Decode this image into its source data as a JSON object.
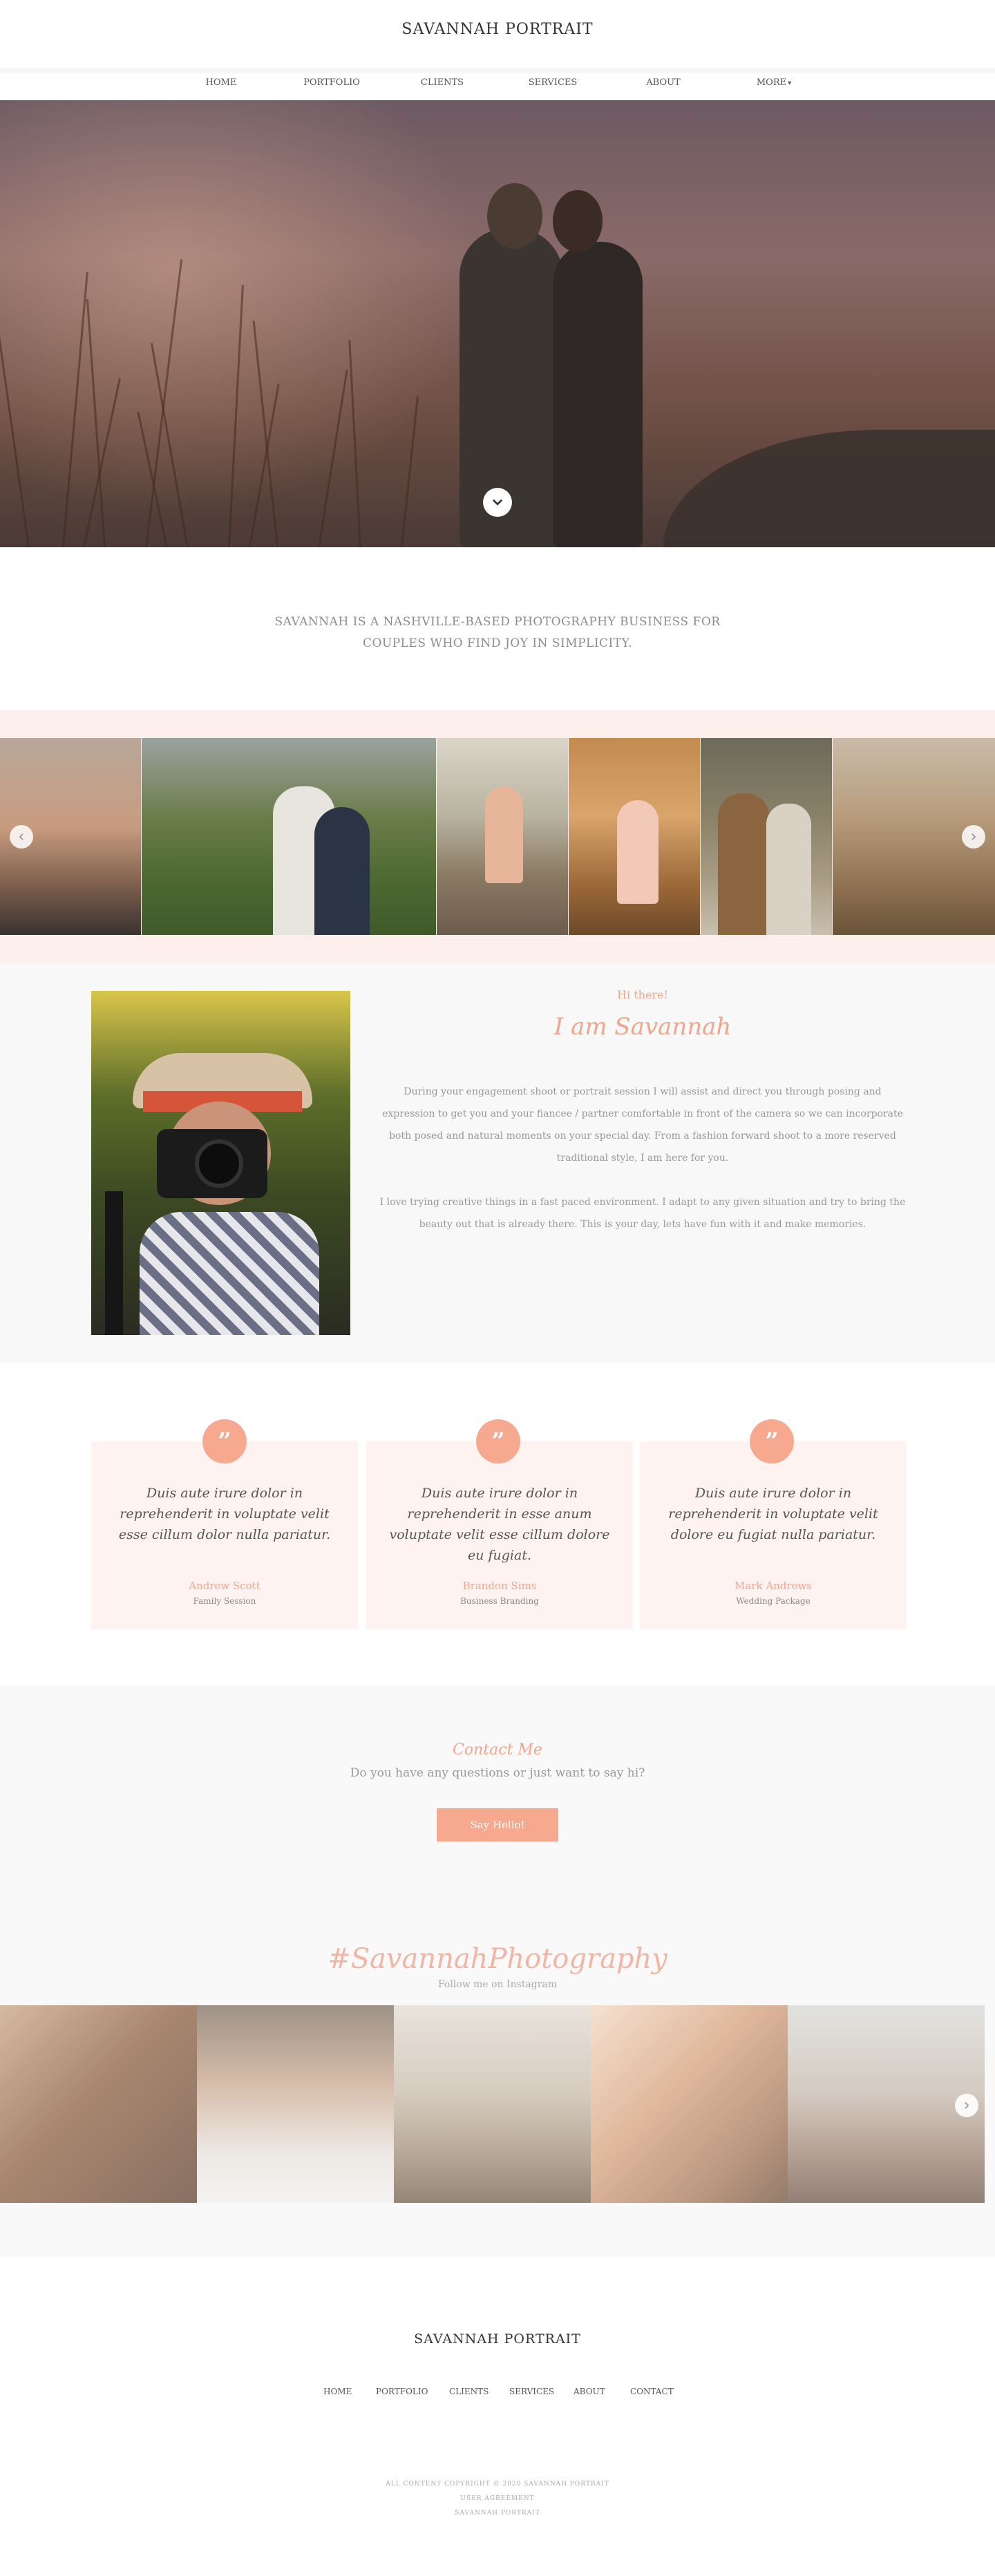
{
  "header": {
    "brand": "SAVANNAH PORTRAIT",
    "nav": [
      {
        "label": "HOME"
      },
      {
        "label": "PORTFOLIO"
      },
      {
        "label": "CLIENTS"
      },
      {
        "label": "SERVICES"
      },
      {
        "label": "ABOUT"
      },
      {
        "label": "MORE"
      }
    ]
  },
  "hero": {
    "scroll_icon": "chevron-down-icon"
  },
  "intro": {
    "text": "SAVANNAH IS A NASHVILLE-BASED PHOTOGRAPHY BUSINESS FOR COUPLES WHO FIND JOY IN SIMPLICITY."
  },
  "gallery": {
    "prev_icon": "chevron-left-icon",
    "next_icon": "chevron-right-icon"
  },
  "about": {
    "greeting": "Hi there!",
    "heading": "I am Savannah",
    "paragraph1": "During your engagement shoot or portrait session I will assist and direct you through posing and expression to get you and your fiancee / partner comfortable in front of the camera so we can incorporate both posed and natural moments on your special day. From a fashion forward shoot to a more reserved traditional style, I am here for you.",
    "paragraph2": "I love trying creative things in a fast paced environment. I adapt to any given situation and try to bring the beauty out that is already there. This is your day, lets have fun with it and make memories."
  },
  "testimonials": [
    {
      "quote": "Duis aute irure dolor in reprehenderit in voluptate velit esse cillum dolor nulla pariatur.",
      "name": "Andrew Scott",
      "role": "Family Session"
    },
    {
      "quote": "Duis aute irure dolor in reprehenderit in esse anum voluptate velit esse cillum dolore eu fugiat.",
      "name": "Brandon Sims",
      "role": "Business Branding"
    },
    {
      "quote": "Duis aute irure dolor in reprehenderit in voluptate velit dolore eu fugiat nulla pariatur.",
      "name": "Mark Andrews",
      "role": "Wedding Package"
    }
  ],
  "contact": {
    "heading": "Contact Me",
    "subtitle": "Do you have any questions or just want to say hi?",
    "button": "Say Hello!"
  },
  "instagram": {
    "heading": "#SavannahPhotography",
    "subtitle": "Follow me on Instagram"
  },
  "footer": {
    "brand": "SAVANNAH PORTRAIT",
    "links": [
      {
        "label": "HOME"
      },
      {
        "label": "PORTFOLIO"
      },
      {
        "label": "CLIENTS"
      },
      {
        "label": "SERVICES"
      },
      {
        "label": "ABOUT"
      },
      {
        "label": "CONTACT"
      }
    ],
    "copyright": "ALL CONTENT COPYRIGHT © 2020 SAVANNAH PORTRAIT",
    "line2": "USER AGREEMENT",
    "line3": "SAVANNAH PORTRAIT"
  },
  "colors": {
    "accent": "#f6a98f",
    "accent_text": "#f2a58d",
    "band": "#fdf0ec"
  }
}
